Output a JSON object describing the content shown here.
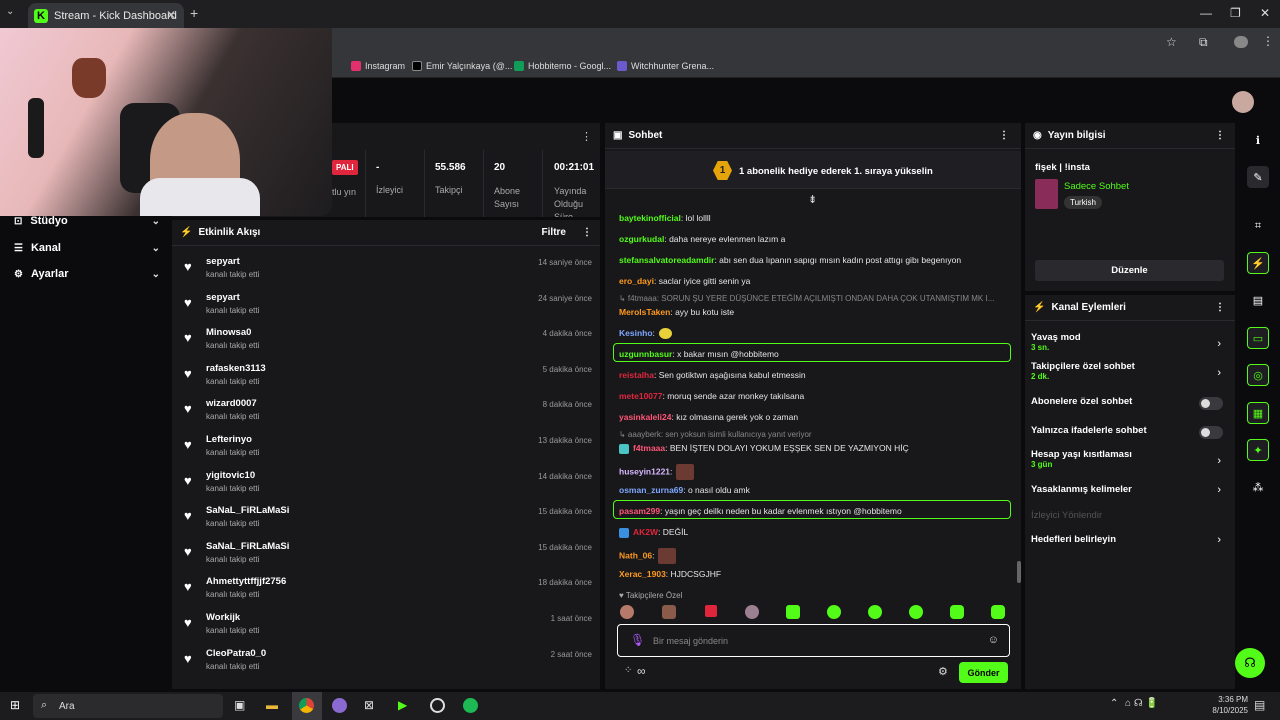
{
  "browser": {
    "tab_title": "Stream - Kick Dashboard",
    "tab_close": "✕",
    "new_tab": "+",
    "bookmarks": [
      "Instagram",
      "Emir Yalçınkaya (@...",
      "Hobbitemo - Googl...",
      "Witchhunter Grena..."
    ]
  },
  "sidebar": {
    "items": [
      {
        "label": "Stüdyo"
      },
      {
        "label": "Kanal"
      },
      {
        "label": "Ayarlar"
      }
    ]
  },
  "stats": {
    "live_badge": "PALI",
    "live_label": "tlu yın",
    "viewers_value": "-",
    "viewers_label": "İzleyici",
    "followers_value": "55.586",
    "followers_label": "Takipçi",
    "subs_value": "20",
    "subs_label": "Abone Sayısı",
    "uptime_value": "00:21:01",
    "uptime_label": "Yayında Olduğu Süre"
  },
  "activity": {
    "title": "Etkinlik Akışı",
    "filter": "Filtre",
    "items": [
      {
        "name": "sepyart",
        "sub": "kanalı takip etti",
        "time": "14 saniye önce"
      },
      {
        "name": "sepyart",
        "sub": "kanalı takip etti",
        "time": "24 saniye önce"
      },
      {
        "name": "Minowsa0",
        "sub": "kanalı takip etti",
        "time": "4 dakika önce"
      },
      {
        "name": "rafasken3113",
        "sub": "kanalı takip etti",
        "time": "5 dakika önce"
      },
      {
        "name": "wizard0007",
        "sub": "kanalı takip etti",
        "time": "8 dakika önce"
      },
      {
        "name": "Lefterinyo",
        "sub": "kanalı takip etti",
        "time": "13 dakika önce"
      },
      {
        "name": "yigitovic10",
        "sub": "kanalı takip etti",
        "time": "14 dakika önce"
      },
      {
        "name": "SaNaL_FiRLaMaSi",
        "sub": "kanalı takip etti",
        "time": "15 dakika önce"
      },
      {
        "name": "SaNaL_FiRLaMaSi",
        "sub": "kanalı takip etti",
        "time": "15 dakika önce"
      },
      {
        "name": "Ahmettyttffjjf2756",
        "sub": "kanalı takip etti",
        "time": "18 dakika önce"
      },
      {
        "name": "Workijk",
        "sub": "kanalı takip etti",
        "time": "1 saat önce"
      },
      {
        "name": "CleoPatra0_0",
        "sub": "kanalı takip etti",
        "time": "2 saat önce"
      }
    ]
  },
  "chat": {
    "title": "Sohbet",
    "pinned_badge": "1",
    "pinned": "1 abonelik hediye ederek 1. sıraya yükselin",
    "messages": [
      {
        "user": "baytekinofficial",
        "text": ": lol lollll",
        "color": "#53fc18"
      },
      {
        "user": "ozgurkudal",
        "text": ": daha nereye evlenmen lazım a",
        "color": "#53fc18"
      },
      {
        "user": "stefansalvatoreadamdir",
        "text": ": abı sen dua lıpanın sapıgı mısın kadın post attıgı gibı begenıyon",
        "color": "#53fc18"
      },
      {
        "user": "ero_dayi",
        "text": ": saclar iyice gitti senin ya",
        "color": "#ff9a1f"
      },
      {
        "user": "MerolsTaken",
        "text": ": ayy bu kotu iste",
        "color": "#ff9a1f"
      },
      {
        "user": "Kesinho",
        "text": ":",
        "color": "#7fa8ff"
      },
      {
        "user": "uzgunnbasur",
        "text": ": x bakar mısın @hobbitemo",
        "color": "#53fc18"
      },
      {
        "user": "reistalha",
        "text": ": Sen gotiktwn aşağısına kabul etmessin",
        "color": "#e0263c"
      },
      {
        "user": "mete10077",
        "text": ": moruq sende azar monkey takılsana",
        "color": "#e0263c"
      },
      {
        "user": "yasinkaleli24",
        "text": ": kız olmasına gerek yok o zaman",
        "color": "#ff5577"
      },
      {
        "user": "f4tmaaa",
        "text": ": BEN İŞTEN DOLAYI YOKUM EŞŞEK SEN DE YAZMIYON HİÇ",
        "color": "#ff5577"
      },
      {
        "user": "huseyin1221",
        "text": ":",
        "color": "#d7b7ff"
      },
      {
        "user": "osman_zurna69",
        "text": ": o nasıl oldu amk",
        "color": "#7fa8ff"
      },
      {
        "user": "pasam299",
        "text": ": yaşın geç deilkı neden bu kadar evlenmek ıstıyon @hobbitemo",
        "color": "#ff5577"
      },
      {
        "user": "AK2W",
        "text": ": DEĞİL",
        "color": "#e0263c"
      },
      {
        "user": "Nath_06",
        "text": ":",
        "color": "#ff9a1f"
      },
      {
        "user": "Xerac_1903",
        "text": ": HJDCSGJHF",
        "color": "#ff9a1f"
      }
    ],
    "reply1": "↳ f4tmaaa: SORUN ŞU YERE DÜŞÜNCE ETEĞİM AÇILMIŞTI ONDAN DAHA ÇOK UTANMIŞTIM MK I...",
    "reply2": "↳ aaayberk: sen yoksun isimli kullanıcıya yanıt veriyor",
    "followers_only": "♥ Takipçilere Özel",
    "input_placeholder": "Bir mesaj gönderin",
    "send": "Gönder",
    "infinity": "∞"
  },
  "stream_info": {
    "title": "Yayın bilgisi",
    "stream_title": "fişek | !insta",
    "category": "Sadece Sohbet",
    "language": "Turkish",
    "edit": "Düzenle"
  },
  "channel_actions": {
    "title": "Kanal Eylemleri",
    "items": [
      {
        "label": "Yavaş mod",
        "sub": "3 sn.",
        "control": "arrow"
      },
      {
        "label": "Takipçilere özel sohbet",
        "sub": "2 dk.",
        "control": "arrow"
      },
      {
        "label": "Abonelere özel sohbet",
        "sub": "",
        "control": "toggle"
      },
      {
        "label": "Yalnızca ifadelerle sohbet",
        "sub": "",
        "control": "toggle"
      },
      {
        "label": "Hesap yaşı kısıtlaması",
        "sub": "3 gün",
        "control": "arrow"
      },
      {
        "label": "Yasaklanmış kelimeler",
        "sub": "",
        "control": "arrow"
      },
      {
        "label": "İzleyici Yönlendir",
        "sub": "",
        "control": "disabled"
      },
      {
        "label": "Hedefleri belirleyin",
        "sub": "",
        "control": "arrow"
      }
    ]
  },
  "taskbar": {
    "search": "Ara",
    "time": "3:36 PM",
    "date": "8/10/2025"
  },
  "colors": {
    "accent": "#53fc18",
    "panel": "#18181b",
    "background": "#0b0b0d"
  }
}
